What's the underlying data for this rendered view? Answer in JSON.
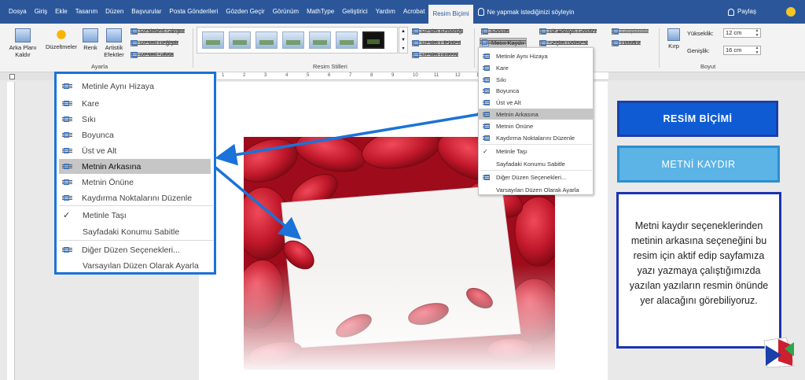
{
  "ribbon_tabs": [
    "Dosya",
    "Giriş",
    "Ekle",
    "Tasarım",
    "Düzen",
    "Başvurular",
    "Posta Gönderileri",
    "Gözden Geçir",
    "Görünüm",
    "MathType",
    "Geliştirici",
    "Yardım",
    "Acrobat",
    "Resim Biçimi"
  ],
  "tell_me": "Ne yapmak istediğinizi söyleyin",
  "share": "Paylaş",
  "ribbon": {
    "arka_plani_kaldir": "Arka Planı Kaldır",
    "duzeltmeler": "Düzeltmeler",
    "renk": "Renk",
    "artistik_efektler": "Artistik Efektler",
    "resimleri_sikistir": "Resimleri Sıkıştır",
    "resmi_degistir": "Resmi Değiştir",
    "resmi_sifirla": "Resmi Sıfırla",
    "group_ayarla": "Ayarla",
    "group_resim_stilleri": "Resim Stilleri",
    "resim_kenarligi": "Resim Kenarlığı",
    "resim_efektleri": "Resim Efektleri",
    "resim_duzeni": "Resim Düzeni",
    "konum": "Konum",
    "metni_kaydir": "Metni Kaydır",
    "bir_arkaya_gonder": "Bir Arkaya Gönder",
    "secim_bolmesi": "Seçim Bölmesi",
    "grupla": "Gruplandır",
    "dondur": "Döndür",
    "kirp": "Kırp",
    "yukseklik_label": "Yükseklik:",
    "yukseklik_value": "12 cm",
    "genislik_label": "Genişlik:",
    "genislik_value": "16 cm",
    "group_boyut": "Boyut"
  },
  "ruler_numbers": [
    "1",
    "2",
    "3",
    "4",
    "5",
    "6",
    "7",
    "8",
    "9",
    "10",
    "11",
    "12",
    "13",
    "14",
    "15",
    "16",
    "17",
    "18"
  ],
  "big_menu": {
    "items": [
      "Metinle Aynı Hizaya",
      "Kare",
      "Sıkı",
      "Boyunca",
      "Üst ve Alt",
      "Metnin Arkasına",
      "Metnin Önüne",
      "Kaydırma Noktalarını Düzenle",
      "Metinle Taşı",
      "Sayfadaki Konumu Sabitle",
      "Diğer Düzen Seçenekleri...",
      "Varsayılan Düzen Olarak Ayarla"
    ],
    "selected_index": 5,
    "check_mark": "✓"
  },
  "small_menu": {
    "items": [
      "Metinle Aynı Hizaya",
      "Kare",
      "Sıkı",
      "Boyunca",
      "Üst ve Alt",
      "Metnin Arkasına",
      "Metnin Önüne",
      "Kaydırma Noktalarını Düzenle",
      "Metinle Taşı",
      "Sayfadaki Konumu Sabitle",
      "Diğer Düzen Seçenekleri...",
      "Varsayılan Düzen Olarak Ayarla"
    ],
    "selected_index": 5,
    "check_mark": "✓"
  },
  "side_panels": {
    "title1": "RESİM BİÇİMİ",
    "title2": "METNİ KAYDIR",
    "description": "Metni kaydır seçeneklerinden metinin arkasına seçeneğini bu resim için aktif edip sayfamıza yazı yazmaya çalıştığımızda yazılan yazıların resmin önünde yer alacağını görebiliyoruz."
  },
  "colors": {
    "accent_blue": "#2b579a",
    "highlight_blue": "#1b72d8",
    "panel_blue": "#0f5bd4",
    "panel_light_blue": "#5cb3e6",
    "rose_red": "#b01020"
  },
  "icons": [
    "bulb-icon",
    "person-icon",
    "smiley-icon",
    "sun-icon",
    "check-icon",
    "wrap-icon",
    "logo-icon"
  ]
}
